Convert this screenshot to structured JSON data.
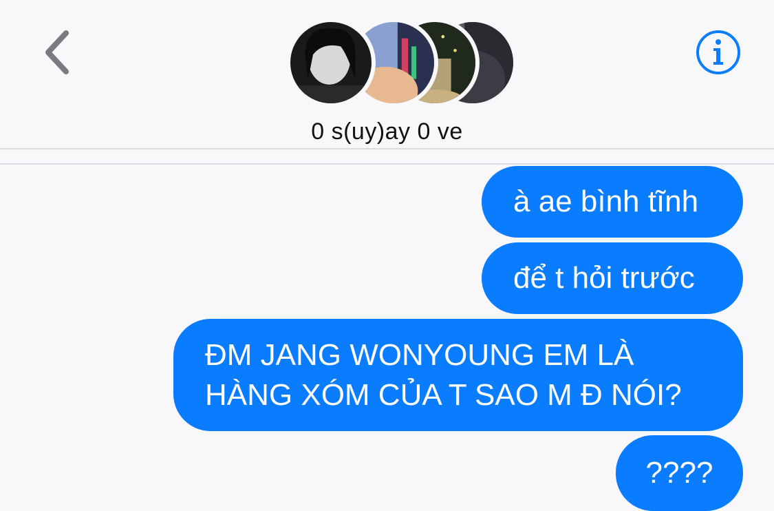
{
  "header": {
    "group_name": "0 s(uy)ay 0 ve",
    "back_icon": "chevron-left-icon",
    "info_icon": "info-circle-icon",
    "accent_color": "#0a7cff"
  },
  "messages": [
    {
      "text": "à ae bình tĩnh",
      "direction": "outgoing"
    },
    {
      "text": "để t hỏi trước",
      "direction": "outgoing"
    },
    {
      "text": "ĐM JANG WONYOUNG EM LÀ\nHÀNG XÓM CỦA T SAO M Đ NÓI?",
      "line1": "ĐM JANG WONYOUNG EM LÀ",
      "line2": "HÀNG XÓM CỦA T SAO M Đ NÓI?",
      "direction": "outgoing"
    },
    {
      "text": "????",
      "direction": "outgoing"
    }
  ]
}
